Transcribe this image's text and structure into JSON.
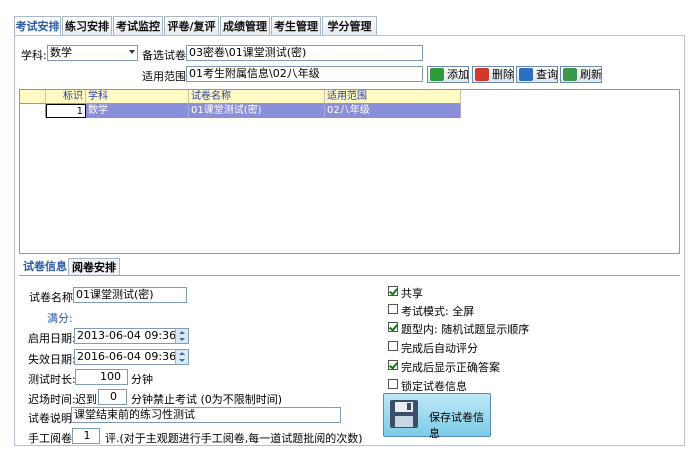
{
  "tabs": [
    "考试安排",
    "练习安排",
    "考试监控",
    "评卷/复评",
    "成绩管理",
    "考生管理",
    "学分管理"
  ],
  "filters": {
    "subject_label": "学科:",
    "subject_value": "数学",
    "paper_label": "备选试卷:",
    "paper_value": "03密卷\\01课堂测试(密)",
    "scope_label": "适用范围:",
    "scope_value": "01考生附属信息\\02八年级"
  },
  "buttons": {
    "add": "添加",
    "delete": "删除",
    "query": "查询",
    "refresh": "刷新"
  },
  "colors": {
    "add": "#2f9a3a",
    "delete": "#d13a2a",
    "query": "#2d6fc0",
    "refresh": "#3a9a4a",
    "selected_row": "#8b8ed8",
    "header_bg": "#fff9c4"
  },
  "grid": {
    "columns": [
      "标识",
      "学科",
      "试卷名称",
      "适用范围"
    ],
    "rows": [
      {
        "id": "1",
        "subject": "数学",
        "paper": "01课堂测试(密)",
        "scope": "02八年级"
      }
    ]
  },
  "lower_tabs": [
    "试卷信息",
    "阅卷安排"
  ],
  "form": {
    "name_label": "试卷名称:",
    "name_value": "01课堂测试(密)",
    "score_label": "满分:",
    "start_label": "启用日期:",
    "start_value": "2013-06-04 09:36:02",
    "end_label": "失效日期:",
    "end_value": "2016-06-04 09:36:02",
    "duration_label": "测试时长:",
    "duration_value": "100",
    "duration_unit": "分钟",
    "late_label": "迟场时间:",
    "late_prefix": "迟到",
    "late_value": "0",
    "late_suffix": "分钟禁止考试 (0为不限制时间)",
    "desc_label": "试卷说明:",
    "desc_value": "课堂结束前的练习性测试",
    "manual_label": "手工阅卷:",
    "manual_value": "1",
    "manual_suffix": "评.(对于主观题进行手工阅卷,每一道试题批阅的次数)"
  },
  "options": [
    {
      "label": "共享",
      "checked": true
    },
    {
      "label": "考试模式: 全屏",
      "checked": false
    },
    {
      "label": "题型内: 随机试题显示顺序",
      "checked": true
    },
    {
      "label": "完成后自动评分",
      "checked": false
    },
    {
      "label": "完成后显示正确答案",
      "checked": true
    },
    {
      "label": "锁定试卷信息",
      "checked": false
    }
  ],
  "save_button": "保存试卷信息",
  "icons": {
    "save": "floppy-disk-icon"
  }
}
